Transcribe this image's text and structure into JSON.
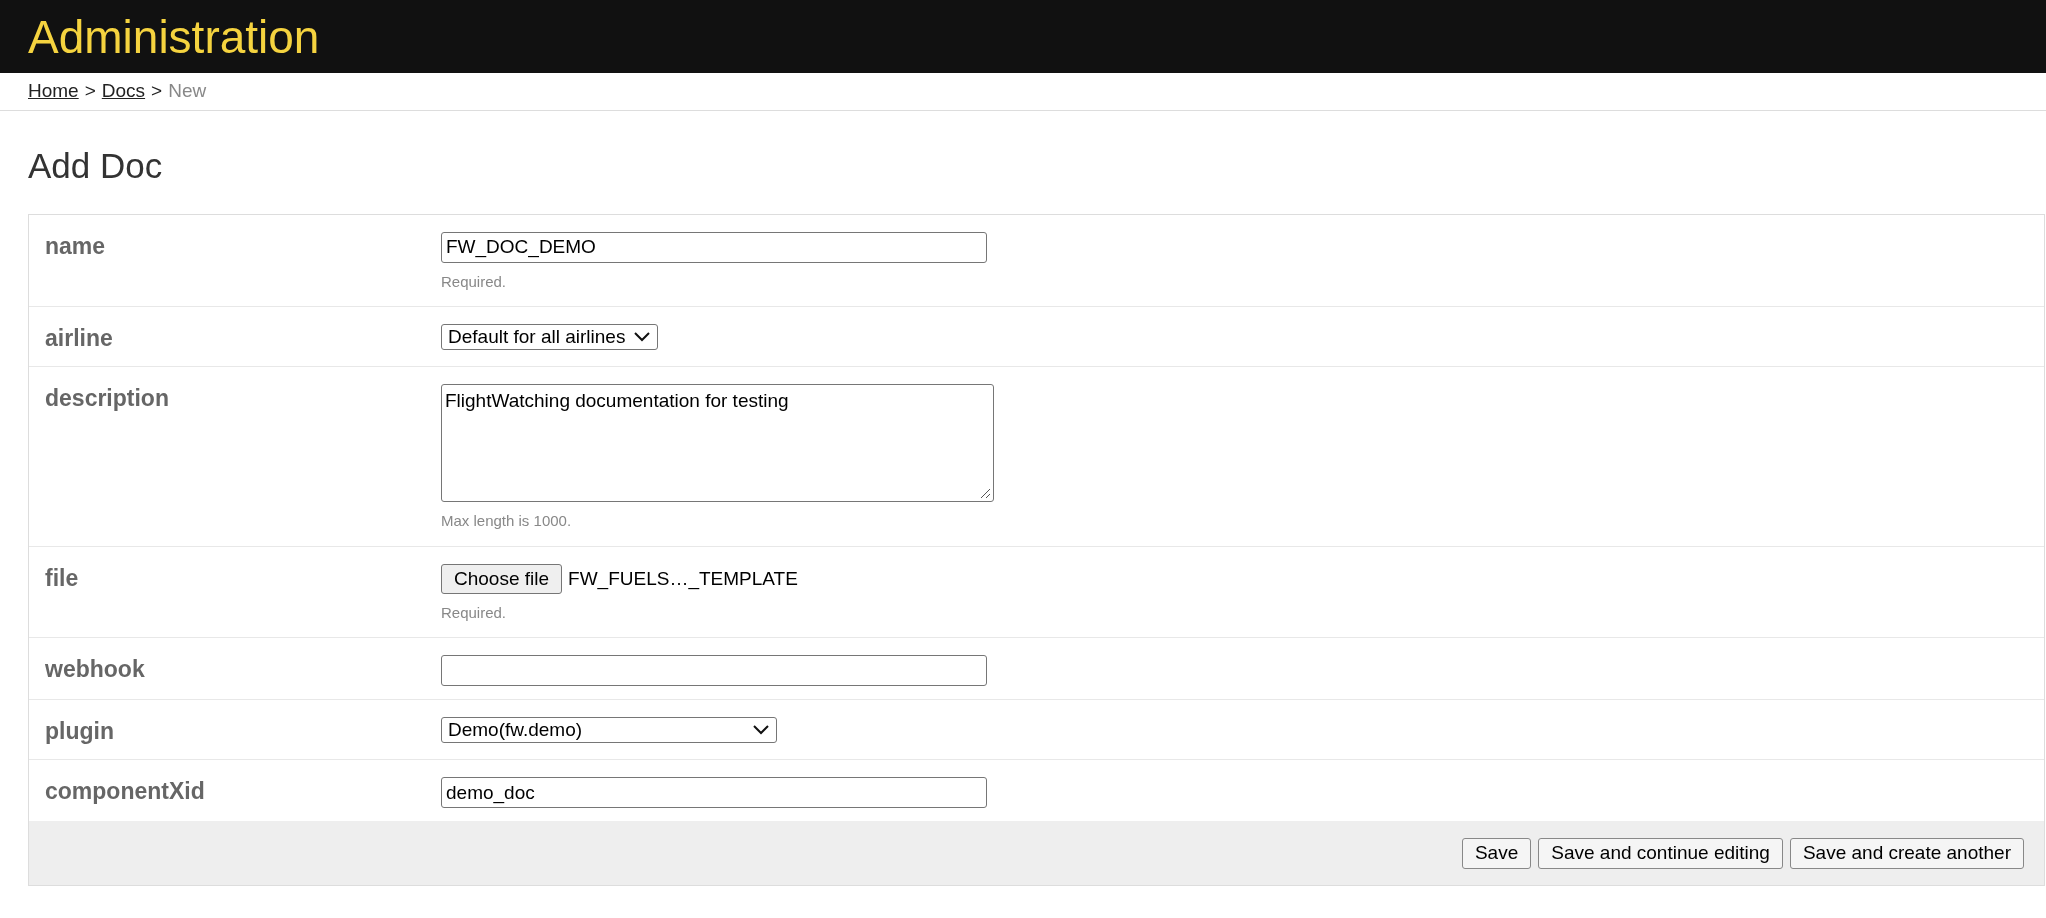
{
  "header": {
    "title": "Administration"
  },
  "breadcrumbs": [
    {
      "label": "Home",
      "link": true
    },
    {
      "label": "Docs",
      "link": true
    },
    {
      "label": "New",
      "link": false
    }
  ],
  "breadcrumb_separator": ">",
  "page_title": "Add Doc",
  "fields": [
    {
      "label": "name",
      "kind": "text",
      "value": "FW_DOC_DEMO",
      "help": "Required."
    },
    {
      "label": "airline",
      "kind": "select",
      "value": "Default for all airlines",
      "wide": false
    },
    {
      "label": "description",
      "kind": "textarea",
      "value": "FlightWatching documentation for testing",
      "help": "Max length is 1000."
    },
    {
      "label": "file",
      "kind": "file",
      "button": "Choose file",
      "value": "FW_FUELS…_TEMPLATE",
      "help": "Required."
    },
    {
      "label": "webhook",
      "kind": "text"
    },
    {
      "label": "plugin",
      "kind": "select",
      "value": "Demo(fw.demo)",
      "wide": true
    },
    {
      "label": "componentXid",
      "kind": "text",
      "value": "demo_doc"
    }
  ],
  "buttons": [
    "Save",
    "Save and continue editing",
    "Save and create another"
  ]
}
